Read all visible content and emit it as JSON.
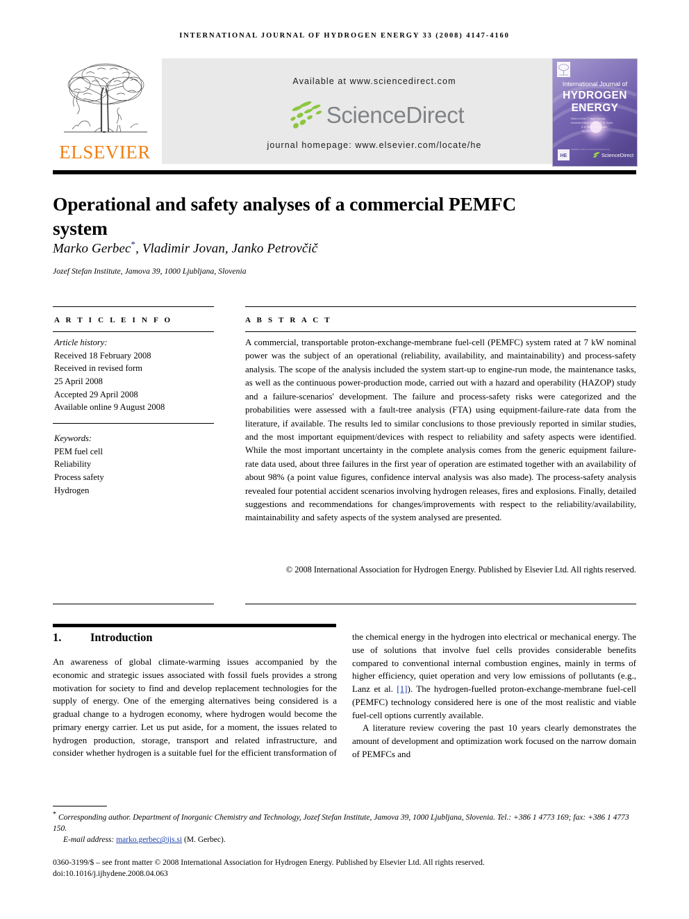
{
  "running_head": "INTERNATIONAL JOURNAL OF HYDROGEN ENERGY 33 (2008) 4147-4160",
  "masthead": {
    "publisher_name": "ELSEVIER",
    "available_at": "Available at www.sciencedirect.com",
    "sciencedirect_wordmark": "ScienceDirect",
    "journal_homepage": "journal homepage: www.elsevier.com/locate/he",
    "cover": {
      "line1": "International Journal of",
      "line2": "HYDROGEN",
      "line3": "ENERGY",
      "editor_lines": "Editor-in-Chief: T. Nejat Veziroglu   Associate Editors: F. Barbir, R. B. Gupta, S. A. Sherif, J. M. Ogden, Jon-Chi Lin",
      "sciencedirect_label": "ScienceDirect"
    }
  },
  "article": {
    "title": "Operational and safety analyses of a commercial PEMFC system",
    "authors": "Marko Gerbec",
    "authors_rest": ", Vladimir Jovan, Janko Petrovčič",
    "corresponding_marker": "*",
    "affiliation": "Jozef Stefan Institute, Jamova 39, 1000 Ljubljana, Slovenia"
  },
  "article_info": {
    "heading": "A R T I C L E   I N F O",
    "history_label": "Article history:",
    "history": [
      "Received 18 February 2008",
      "Received in revised form",
      "25 April 2008",
      "Accepted 29 April 2008",
      "Available online 9 August 2008"
    ],
    "keywords_label": "Keywords:",
    "keywords": [
      "PEM fuel cell",
      "Reliability",
      "Process safety",
      "Hydrogen"
    ]
  },
  "abstract": {
    "heading": "A B S T R A C T",
    "text": "A commercial, transportable proton-exchange-membrane fuel-cell (PEMFC) system rated at 7 kW nominal power was the subject of an operational (reliability, availability, and maintainability) and process-safety analysis. The scope of the analysis included the system start-up to engine-run mode, the maintenance tasks, as well as the continuous power-production mode, carried out with a hazard and operability (HAZOP) study and a failure-scenarios' development. The failure and process-safety risks were categorized and the probabilities were assessed with a fault-tree analysis (FTA) using equipment-failure-rate data from the literature, if available. The results led to similar conclusions to those previously reported in similar studies, and the most important equipment/devices with respect to reliability and safety aspects were identified. While the most important uncertainty in the complete analysis comes from the generic equipment failure-rate data used, about three failures in the first year of operation are estimated together with an availability of about 98% (a point value figures, confidence interval analysis was also made). The process-safety analysis revealed four potential accident scenarios involving hydrogen releases, fires and explosions. Finally, detailed suggestions and recommendations for changes/improvements with respect to the reliability/availability, maintainability and safety aspects of the system analysed are presented.",
    "copyright": "© 2008 International Association for Hydrogen Energy. Published by Elsevier Ltd. All rights reserved."
  },
  "body": {
    "section_number": "1.",
    "section_title": "Introduction",
    "left_column": "An awareness of global climate-warming issues accompanied by the economic and strategic issues associated with fossil fuels provides a strong motivation for society to find and develop replacement technologies for the supply of energy. One of the emerging alternatives being considered is a gradual change to a hydrogen economy, where hydrogen would become the primary energy carrier. Let us put aside, for a moment, the issues related to hydrogen production, storage, transport and related infrastructure, and consider whether hydrogen is a suitable fuel for the efficient transformation of",
    "right_column_part1": "the chemical energy in the hydrogen into electrical or mechanical energy. The use of solutions that involve fuel cells provides considerable benefits compared to conventional internal combustion engines, mainly in terms of higher efficiency, quiet operation and very low emissions of pollutants (e.g., Lanz et al. ",
    "right_column_citation": "[1]",
    "right_column_part2": "). The hydrogen-fuelled proton-exchange-membrane fuel-cell (PEMFC) technology considered here is one of the most realistic and viable fuel-cell options currently available.",
    "right_column_para2": "A literature review covering the past 10 years clearly demonstrates the amount of development and optimization work focused on the narrow domain of PEMFCs and"
  },
  "footnotes": {
    "corresponding": "Corresponding author. Department of Inorganic Chemistry and Technology, Jozef Stefan Institute, Jamova 39, 1000 Ljubljana, Slovenia. Tel.: +386 1 4773 169; fax: +386 1 4773 150.",
    "email_label": "E-mail address:",
    "email": "marko.gerbec@ijs.si",
    "email_owner": "(M. Gerbec).",
    "issn_line": "0360-3199/$ – see front matter © 2008 International Association for Hydrogen Energy. Published by Elsevier Ltd. All rights reserved.",
    "doi_line": "doi:10.1016/j.ijhydene.2008.04.063"
  },
  "colors": {
    "elsevier_orange": "#F07F13",
    "link_blue": "#1a3fae",
    "banner_gray": "#e9e9e9",
    "sciencedirect_gray": "#808285",
    "leaf_green": "#8cc63f"
  }
}
